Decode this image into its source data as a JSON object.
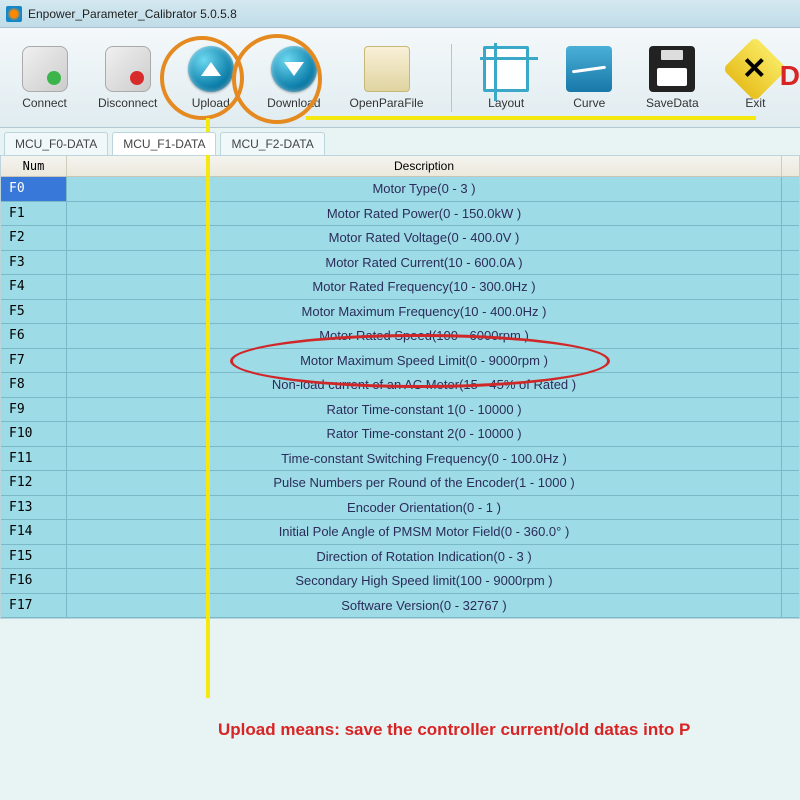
{
  "window": {
    "title": "Enpower_Parameter_Calibrator  5.0.5.8"
  },
  "toolbar": {
    "connect": "Connect",
    "disconnect": "Disconnect",
    "upload": "Upload",
    "download": "Download",
    "openparafile": "OpenParaFile",
    "layout": "Layout",
    "curve": "Curve",
    "savedata": "SaveData",
    "exit": "Exit"
  },
  "tabs": [
    {
      "label": "MCU_F0-DATA"
    },
    {
      "label": "MCU_F1-DATA"
    },
    {
      "label": "MCU_F2-DATA"
    }
  ],
  "grid": {
    "headers": {
      "num": "Num",
      "desc": "Description"
    },
    "rows": [
      {
        "num": "F0",
        "desc": "Motor Type(0 - 3 )"
      },
      {
        "num": "F1",
        "desc": "Motor Rated Power(0 - 150.0kW )"
      },
      {
        "num": "F2",
        "desc": "Motor Rated Voltage(0 - 400.0V )"
      },
      {
        "num": "F3",
        "desc": "Motor Rated Current(10 - 600.0A )"
      },
      {
        "num": "F4",
        "desc": "Motor Rated Frequency(10 - 300.0Hz )"
      },
      {
        "num": "F5",
        "desc": "Motor Maximum Frequency(10 - 400.0Hz )"
      },
      {
        "num": "F6",
        "desc": "Motor Rated Speed(100 - 6000rpm )"
      },
      {
        "num": "F7",
        "desc": "Motor Maximum Speed Limit(0 - 9000rpm )"
      },
      {
        "num": "F8",
        "desc": "Non-load current of an AC Motor(15 - 45% of Rated )"
      },
      {
        "num": "F9",
        "desc": "Rator Time-constant 1(0 - 10000 )"
      },
      {
        "num": "F10",
        "desc": "Rator Time-constant 2(0 - 10000 )"
      },
      {
        "num": "F11",
        "desc": "Time-constant Switching Frequency(0 - 100.0Hz )"
      },
      {
        "num": "F12",
        "desc": "Pulse Numbers per Round of the Encoder(1 - 1000 )"
      },
      {
        "num": "F13",
        "desc": "Encoder Orientation(0 - 1 )"
      },
      {
        "num": "F14",
        "desc": "Initial Pole Angle of PMSM Motor Field(0 - 360.0° )"
      },
      {
        "num": "F15",
        "desc": "Direction of Rotation Indication(0 - 3 )"
      },
      {
        "num": "F16",
        "desc": "Secondary High Speed limit(100 - 9000rpm )"
      },
      {
        "num": "F17",
        "desc": "Software Version(0 - 32767 )"
      }
    ]
  },
  "annotations": {
    "note": "Upload means: save the controller current/old datas into P",
    "d_cut": "D"
  }
}
